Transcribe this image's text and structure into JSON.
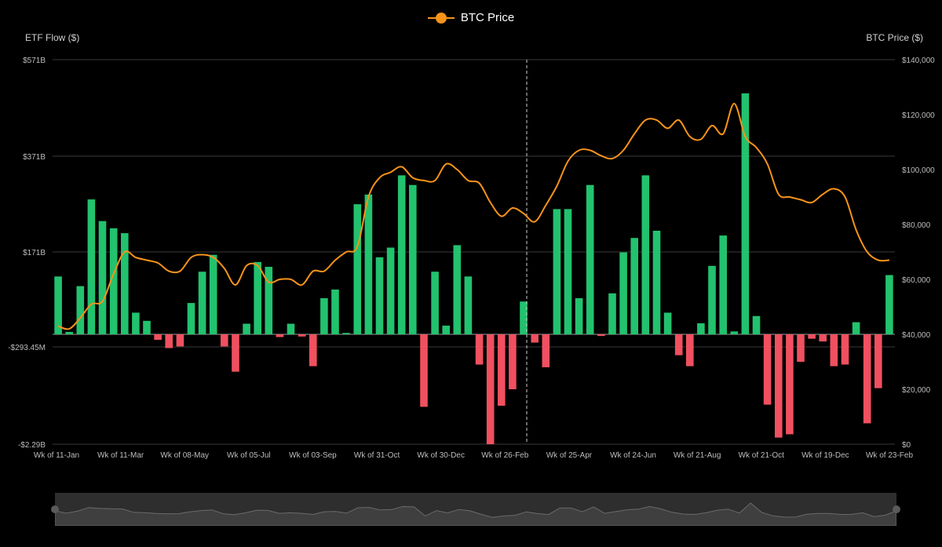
{
  "legend": {
    "label": "BTC Price"
  },
  "axes": {
    "left_title": "ETF Flow ($)",
    "right_title": "BTC Price ($)"
  },
  "colors": {
    "positive_bar": "#22c26e",
    "negative_bar": "#f0505f",
    "line": "#f7931a",
    "grid": "#3a3a3a"
  },
  "chart_data": {
    "type": "bar",
    "title": "",
    "legend_position": "top-center",
    "grid": true,
    "left_axis": {
      "label": "ETF Flow ($)",
      "tick_labels": [
        "$571B",
        "$371B",
        "$171B",
        "-$293.45M",
        "-$2.29B"
      ]
    },
    "right_axis": {
      "label": "BTC Price ($)",
      "ylim": [
        0,
        140000
      ],
      "tick_labels": [
        "$140,000",
        "$120,000",
        "$100,000",
        "$80,000",
        "$60,000",
        "$40,000",
        "$20,000",
        "$0"
      ]
    },
    "x_tick_labels": [
      "Wk of 11-Jan",
      "Wk of 11-Mar",
      "Wk of 08-May",
      "Wk of 05-Jul",
      "Wk of 03-Sep",
      "Wk of 31-Oct",
      "Wk of 30-Dec",
      "Wk of 26-Feb",
      "Wk of 25-Apr",
      "Wk of 24-Jun",
      "Wk of 21-Aug",
      "Wk of 21-Oct",
      "Wk of 19-Dec",
      "Wk of 23-Feb"
    ],
    "series": [
      {
        "name": "ETF Flow",
        "type": "bar",
        "unit": "B",
        "values": [
          1.2,
          0.05,
          1.0,
          2.8,
          2.35,
          2.2,
          2.1,
          0.45,
          0.28,
          -0.1,
          -0.25,
          -0.22,
          0.65,
          1.3,
          1.65,
          -0.22,
          -0.68,
          0.22,
          1.5,
          1.4,
          -0.05,
          0.22,
          -0.04,
          -0.58,
          0.75,
          0.93,
          0.03,
          2.7,
          2.9,
          1.6,
          1.8,
          3.3,
          3.1,
          -1.32,
          1.3,
          0.18,
          1.85,
          1.2,
          -0.55,
          -2.0,
          -1.3,
          -1.0,
          0.68,
          -0.15,
          -0.6,
          2.6,
          2.6,
          0.75,
          3.1,
          -0.03,
          0.85,
          1.7,
          2.0,
          3.3,
          2.15,
          0.45,
          -0.38,
          -0.58,
          0.23,
          1.42,
          2.05,
          0.06,
          5.0,
          0.38,
          -1.28,
          -1.88,
          -1.82,
          -0.5,
          -0.08,
          -0.13,
          -0.58,
          -0.55,
          0.25,
          -1.62,
          -0.98,
          1.23
        ]
      },
      {
        "name": "BTC Price",
        "type": "line",
        "values": [
          43000,
          42000,
          46000,
          51000,
          52000,
          62000,
          70000,
          68000,
          67000,
          66000,
          63000,
          63000,
          68000,
          69000,
          68000,
          64000,
          58000,
          65000,
          65000,
          59000,
          60000,
          60000,
          58000,
          63000,
          63000,
          67000,
          70000,
          72000,
          90000,
          97000,
          99000,
          101000,
          97000,
          96000,
          96000,
          102000,
          100000,
          96000,
          95000,
          88000,
          83000,
          86000,
          84000,
          81000,
          87000,
          94000,
          103000,
          107000,
          107000,
          105000,
          104000,
          107000,
          113000,
          118000,
          118000,
          115000,
          118000,
          112000,
          111000,
          116000,
          113000,
          124000,
          112000,
          108000,
          102000,
          91000,
          90000,
          89000,
          88000,
          91000,
          93000,
          90000,
          78000,
          70000,
          67000,
          67000
        ]
      }
    ]
  }
}
